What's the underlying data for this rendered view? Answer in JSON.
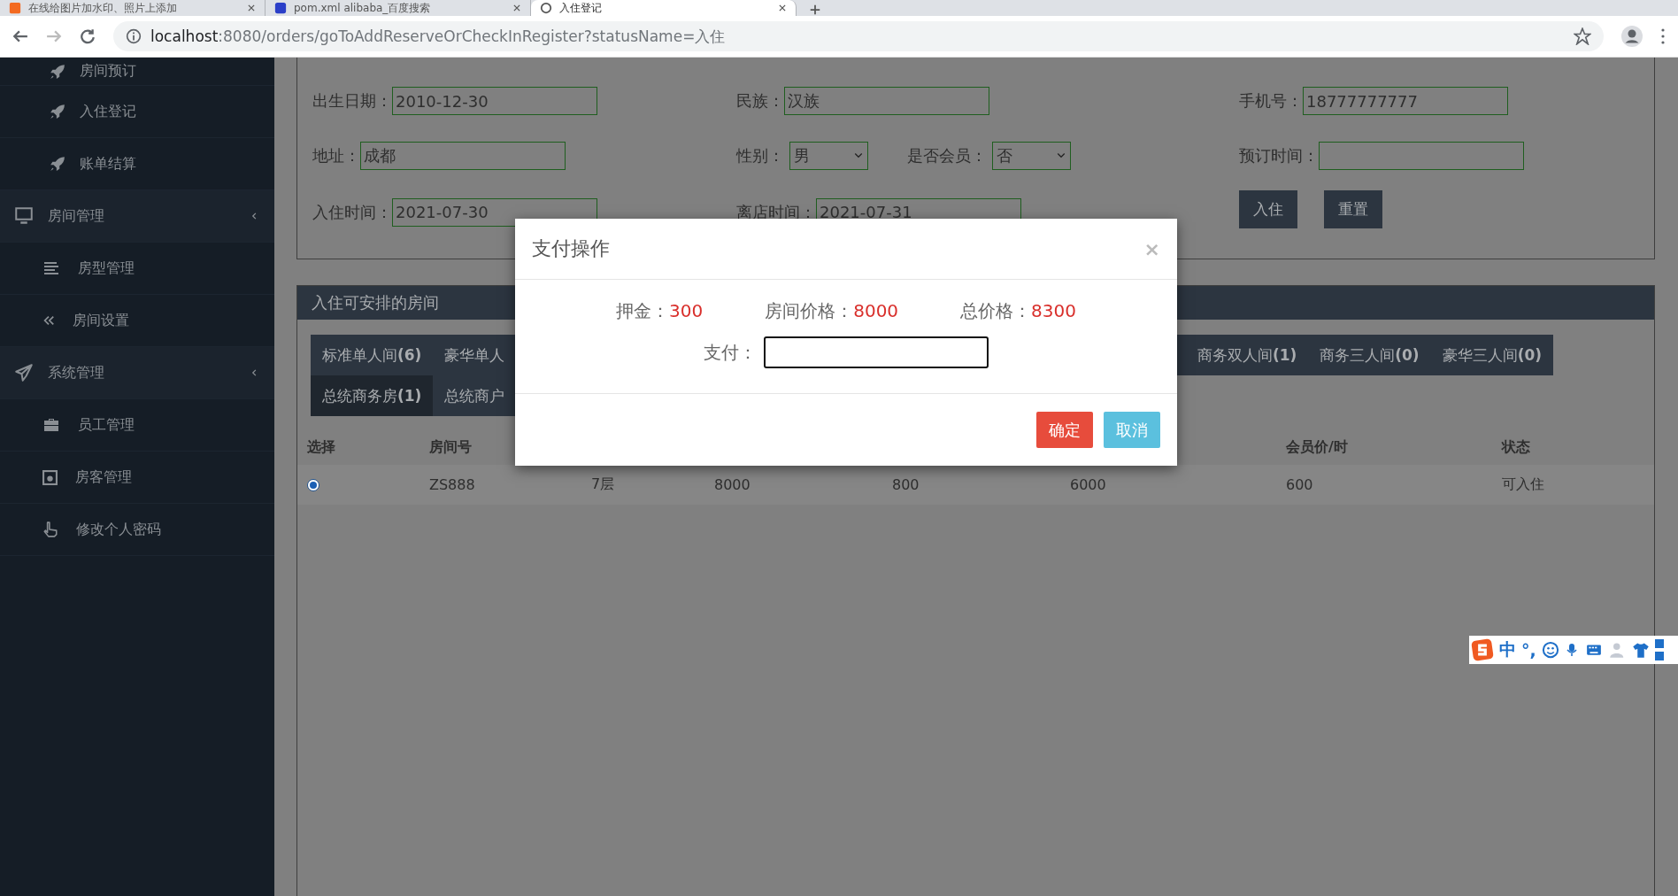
{
  "browser": {
    "tabs": [
      {
        "title": "在线给图片加水印、照片上添加",
        "selected": false
      },
      {
        "title": "pom.xml alibaba_百度搜索",
        "selected": false
      },
      {
        "title": "入住登记",
        "selected": true
      }
    ],
    "url_host": "localhost",
    "url_path": ":8080/orders/goToAddReserveOrCheckInRegister?statusName=入住"
  },
  "sidebar": {
    "items": [
      {
        "label": "房间预订"
      },
      {
        "label": "入住登记"
      },
      {
        "label": "账单结算"
      },
      {
        "label": "房间管理",
        "children": [
          {
            "label": "房型管理"
          },
          {
            "label": "房间设置"
          }
        ]
      },
      {
        "label": "系统管理",
        "children": [
          {
            "label": "员工管理"
          },
          {
            "label": "房客管理"
          },
          {
            "label": "修改个人密码"
          }
        ]
      }
    ]
  },
  "form": {
    "rows": [
      [
        [
          {
            "kind": "input",
            "label": "出生日期：",
            "value": "2010-12-30"
          }
        ],
        [
          {
            "kind": "input",
            "label": "民族：",
            "value": "汉族"
          }
        ],
        [
          {
            "kind": "input",
            "label": "手机号：",
            "value": "18777777777"
          }
        ]
      ],
      [
        [
          {
            "kind": "input",
            "label": "地址：",
            "value": "成都"
          }
        ],
        [
          {
            "kind": "select",
            "label": "性别：",
            "value": "男"
          },
          {
            "kind": "select",
            "label": "是否会员：",
            "value": "否"
          }
        ],
        [
          {
            "kind": "input",
            "label": "预订时间："
          }
        ]
      ],
      [
        [
          {
            "kind": "input",
            "label": "入住时间：",
            "value": "2021-07-30"
          }
        ],
        [
          {
            "kind": "input",
            "label": "离店时间：",
            "value": "2021-07-31"
          }
        ],
        [
          {
            "kind": "button",
            "label": "入住"
          },
          {
            "kind": "button",
            "label": "重置"
          }
        ]
      ]
    ]
  },
  "rooms": {
    "title": "入住可安排的房间",
    "tabs_left": [
      {
        "label": "标准单人间**(6)**",
        "selected": false
      },
      {
        "label": "豪华单人",
        "selected": false
      }
    ],
    "tabs_right": [
      {
        "label": "商务双人间**(1)**",
        "selected": false
      },
      {
        "label": "商务三人间**(0)**",
        "selected": false
      },
      {
        "label": "豪华三人间**(0)**",
        "selected": false
      }
    ],
    "tabs_second_row": [
      {
        "label": "总统商务房**(1)**",
        "selected": true
      },
      {
        "label": "总统商户",
        "selected": false
      }
    ],
    "table": {
      "column_headers": {
        "column_1": "选择",
        "column_2": "房间号",
        "column_7": "会员价/时",
        "column_8": "状态"
      },
      "rows": [
        {
          "selected": true,
          "cells": [
            "ZS888",
            "7层",
            "8000",
            "800",
            "6000",
            "600",
            "可入住"
          ]
        }
      ]
    }
  },
  "modal": {
    "title": "支付操作",
    "close": "×",
    "summary": [
      {
        "label": "押金：",
        "value": "300"
      },
      {
        "label": "房间价格：",
        "value": "8000"
      },
      {
        "label": "总价格：",
        "value": "8300"
      }
    ],
    "pay_label": "支付：",
    "buttons": [
      {
        "label": "确定",
        "kind": "danger"
      },
      {
        "label": "取消",
        "kind": "info"
      }
    ]
  },
  "ime_bar": {
    "items": [
      "中",
      "°,"
    ]
  }
}
